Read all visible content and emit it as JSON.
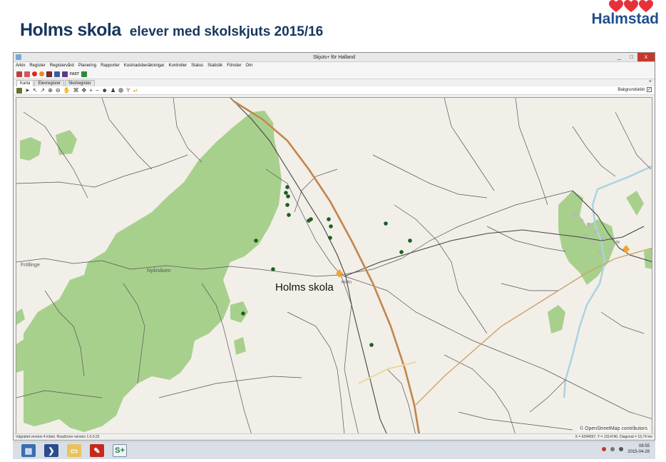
{
  "slide": {
    "title": "Holms skola",
    "subtitle": "elever med skolskjuts 2015/16",
    "logo_text": "Halmstad",
    "logo_color": "#e8303a",
    "title_color": "#17365d"
  },
  "window": {
    "title": "Skjuts+ för Halland",
    "controls": {
      "minimize": "_",
      "maximize": "□",
      "close": "x"
    }
  },
  "menu": [
    "Arkiv",
    "Register",
    "Registervård",
    "Planering",
    "Rapporter",
    "Kostnadsberäkningar",
    "Kontroller",
    "Status",
    "Statistik",
    "Fönster",
    "Om"
  ],
  "toolbar1": {
    "text_label": "FAST"
  },
  "tabs": [
    {
      "label": "Karta",
      "active": true
    },
    {
      "label": "Elevregister",
      "active": false
    },
    {
      "label": "Skolregister",
      "active": false
    }
  ],
  "tab_close": "×",
  "map_toolbar": {
    "background_label": "Bakgrundskikt",
    "background_checked": "✓"
  },
  "map": {
    "school_label": "Holms skola",
    "places": [
      "Nyårsåsen",
      "Fröllinge",
      "Holm"
    ],
    "osm_credit": "© OpenStreetMap contributors",
    "student_color": "#1e5e1e",
    "school_marker_color": "#f2a431",
    "forest_color": "#a8d08d",
    "motorway_color": "#d9a06b"
  },
  "status": {
    "left": "Vägnätet version 4 inläst. RoadLiner version 1.0.0.22",
    "coords": "X = 6294597, Y = 1314740.",
    "diagonal": "Diagonal = 15,74 km"
  },
  "taskbar": {
    "active_label": "S+",
    "clock_time": "08:55",
    "clock_date": "2015-04-28"
  }
}
